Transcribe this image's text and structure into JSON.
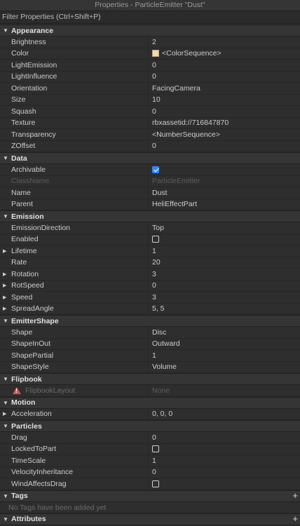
{
  "window": {
    "title": "Properties - ParticleEmitter \"Dust\""
  },
  "filter": {
    "placeholder": "Filter Properties (Ctrl+Shift+P)"
  },
  "sections": [
    {
      "name": "Appearance",
      "rows": [
        {
          "name": "Brightness",
          "value": "2"
        },
        {
          "name": "Color",
          "value": "<ColorSequence>",
          "swatch": "#f0d9b5"
        },
        {
          "name": "LightEmission",
          "value": "0"
        },
        {
          "name": "LightInfluence",
          "value": "0"
        },
        {
          "name": "Orientation",
          "value": "FacingCamera"
        },
        {
          "name": "Size",
          "value": "10"
        },
        {
          "name": "Squash",
          "value": "0"
        },
        {
          "name": "Texture",
          "value": "rbxassetid://716847870"
        },
        {
          "name": "Transparency",
          "value": "<NumberSequence>"
        },
        {
          "name": "ZOffset",
          "value": "0"
        }
      ]
    },
    {
      "name": "Data",
      "rows": [
        {
          "name": "Archivable",
          "checkbox": true,
          "checked": true
        },
        {
          "name": "ClassName",
          "value": "ParticleEmitter",
          "disabled": true
        },
        {
          "name": "Name",
          "value": "Dust"
        },
        {
          "name": "Parent",
          "value": "HeliEffectPart"
        }
      ]
    },
    {
      "name": "Emission",
      "rows": [
        {
          "name": "EmissionDirection",
          "value": "Top"
        },
        {
          "name": "Enabled",
          "checkbox": true,
          "checked": false
        },
        {
          "name": "Lifetime",
          "value": "1",
          "expandable": true
        },
        {
          "name": "Rate",
          "value": "20"
        },
        {
          "name": "Rotation",
          "value": "3",
          "expandable": true
        },
        {
          "name": "RotSpeed",
          "value": "0",
          "expandable": true
        },
        {
          "name": "Speed",
          "value": "3",
          "expandable": true
        },
        {
          "name": "SpreadAngle",
          "value": "5, 5",
          "expandable": true
        }
      ]
    },
    {
      "name": "EmitterShape",
      "rows": [
        {
          "name": "Shape",
          "value": "Disc"
        },
        {
          "name": "ShapeInOut",
          "value": "Outward"
        },
        {
          "name": "ShapePartial",
          "value": "1"
        },
        {
          "name": "ShapeStyle",
          "value": "Volume"
        }
      ]
    },
    {
      "name": "Flipbook",
      "rows": [
        {
          "name": "FlipbookLayout",
          "value": "None",
          "disabled": true,
          "warning": true
        }
      ]
    },
    {
      "name": "Motion",
      "rows": [
        {
          "name": "Acceleration",
          "value": "0, 0, 0",
          "expandable": true
        }
      ]
    },
    {
      "name": "Particles",
      "rows": [
        {
          "name": "Drag",
          "value": "0"
        },
        {
          "name": "LockedToPart",
          "checkbox": true,
          "checked": false
        },
        {
          "name": "TimeScale",
          "value": "1"
        },
        {
          "name": "VelocityInheritance",
          "value": "0"
        },
        {
          "name": "WindAffectsDrag",
          "checkbox": true,
          "checked": false
        }
      ]
    },
    {
      "name": "Tags",
      "addable": true,
      "empty_note": "No Tags have been added yet",
      "rows": []
    },
    {
      "name": "Attributes",
      "addable": true,
      "rows": []
    }
  ]
}
